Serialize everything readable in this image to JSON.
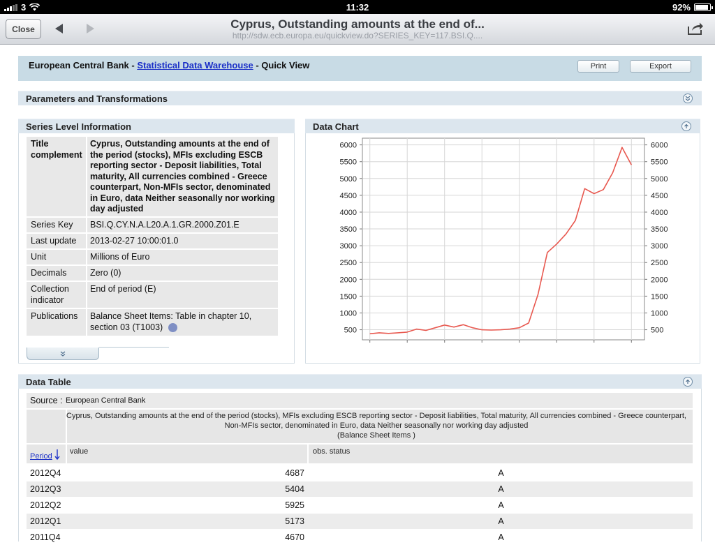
{
  "statusbar": {
    "carrier": "3",
    "time": "11:32",
    "battery": "92%",
    "battery_level": 0.92
  },
  "toolbar": {
    "close_label": "Close",
    "title": "Cyprus, Outstanding amounts at the end of...",
    "url": "http://sdw.ecb.europa.eu/quickview.do?SERIES_KEY=117.BSI.Q...."
  },
  "header": {
    "prefix": "European Central Bank - ",
    "link": "Statistical Data Warehouse",
    "suffix": " - Quick View",
    "print_label": "Print",
    "export_label": "Export"
  },
  "sections": {
    "params": "Parameters and Transformations",
    "series_info": "Series Level Information",
    "data_chart": "Data Chart",
    "data_table": "Data Table"
  },
  "series_info": [
    {
      "key": "Title complement",
      "value": "Cyprus, Outstanding amounts at the end of the period (stocks), MFIs excluding ESCB reporting sector - Deposit liabilities, Total maturity, All currencies combined - Greece counterpart, Non-MFIs sector, denominated in Euro, data Neither seasonally nor working day adjusted"
    },
    {
      "key": "Series Key",
      "value": "BSI.Q.CY.N.A.L20.A.1.GR.2000.Z01.E"
    },
    {
      "key": "Last update",
      "value": "2013-02-27 10:00:01.0"
    },
    {
      "key": "Unit",
      "value": "Millions of Euro"
    },
    {
      "key": "Decimals",
      "value": "Zero (0)"
    },
    {
      "key": "Collection indicator",
      "value": "End of period (E)"
    },
    {
      "key": "Publications",
      "value": "Balance Sheet Items: Table in chapter 10, section 03 (T1003)"
    }
  ],
  "chart_data": {
    "type": "line",
    "x": [
      2006.0,
      2006.25,
      2006.5,
      2006.75,
      2007.0,
      2007.25,
      2007.5,
      2007.75,
      2008.0,
      2008.25,
      2008.5,
      2008.75,
      2009.0,
      2009.25,
      2009.5,
      2009.75,
      2010.0,
      2010.25,
      2010.5,
      2010.75,
      2011.0,
      2011.25,
      2011.5,
      2011.75,
      2012.0,
      2012.25,
      2012.5,
      2012.75,
      2013.0
    ],
    "series": [
      {
        "values": [
          380,
          410,
          390,
          410,
          430,
          520,
          480,
          560,
          640,
          580,
          650,
          560,
          500,
          490,
          500,
          520,
          560,
          700,
          1550,
          2800,
          3050,
          3350,
          3750,
          4700,
          4550,
          4670,
          5173,
          5925,
          5404,
          4687
        ]
      }
    ],
    "x_ticks": [
      "2006",
      "2007",
      "2008",
      "2009",
      "2010",
      "2011",
      "2012",
      "2013"
    ],
    "y_ticks": [
      "500",
      "1000",
      "1500",
      "2000",
      "2500",
      "3000",
      "3500",
      "4000",
      "4500",
      "5000",
      "5500",
      "6000"
    ],
    "xlim": [
      2005.8,
      2013.35
    ],
    "ylim": [
      200,
      6200
    ],
    "grid": true,
    "line_color": "#e8584f"
  },
  "data_table": {
    "source_label": "Source : ",
    "source_value": "European Central Bank",
    "description": "Cyprus, Outstanding amounts at the end of the period (stocks), MFIs excluding ESCB reporting sector - Deposit liabilities, Total maturity, All currencies combined - Greece counterpart, Non-MFIs sector, denominated in Euro, data Neither seasonally nor working day adjusted",
    "subtitle": "(Balance Sheet Items )",
    "col_period": "Period",
    "col_value": "value",
    "col_status": "obs. status",
    "rows": [
      {
        "period": "2012Q4",
        "value": "4687",
        "status": "A"
      },
      {
        "period": "2012Q3",
        "value": "5404",
        "status": "A"
      },
      {
        "period": "2012Q2",
        "value": "5925",
        "status": "A"
      },
      {
        "period": "2012Q1",
        "value": "5173",
        "status": "A"
      },
      {
        "period": "2011Q4",
        "value": "4670",
        "status": "A"
      }
    ]
  }
}
